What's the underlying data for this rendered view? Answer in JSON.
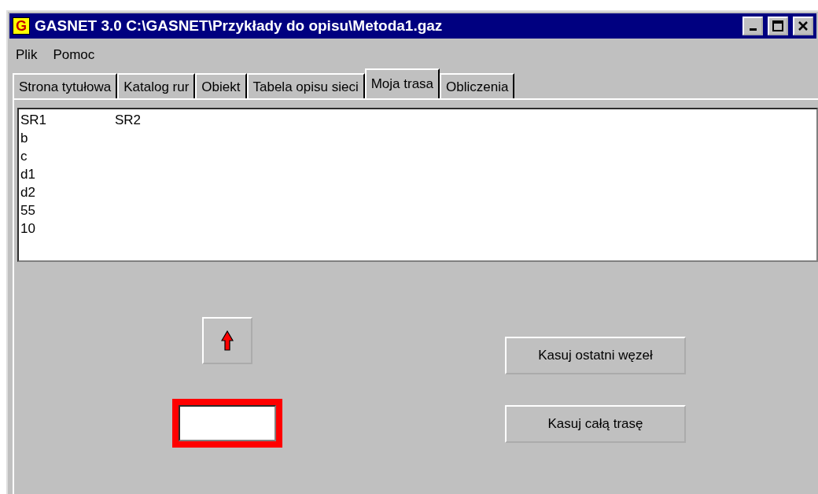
{
  "window": {
    "title": "GASNET 3.0 C:\\GASNET\\Przykłady do opisu\\Metoda1.gaz",
    "app_icon": "G"
  },
  "menu": [
    "Plik",
    "Pomoc"
  ],
  "tabs": [
    {
      "label": "Strona tytułowa",
      "selected": false
    },
    {
      "label": "Katalog rur",
      "selected": false
    },
    {
      "label": "Obiekt",
      "selected": false
    },
    {
      "label": "Tabela opisu sieci",
      "selected": false
    },
    {
      "label": "Moja trasa",
      "selected": true
    },
    {
      "label": "Obliczenia",
      "selected": false
    }
  ],
  "route_list": [
    [
      "SR1",
      "SR2"
    ],
    [
      "b"
    ],
    [
      "c"
    ],
    [
      "d1"
    ],
    [
      "d2"
    ],
    [
      "55"
    ],
    [
      "10"
    ]
  ],
  "buttons": [
    {
      "label": "Kasuj ostatni węzeł"
    },
    {
      "label": "Kasuj całą trasę"
    }
  ]
}
